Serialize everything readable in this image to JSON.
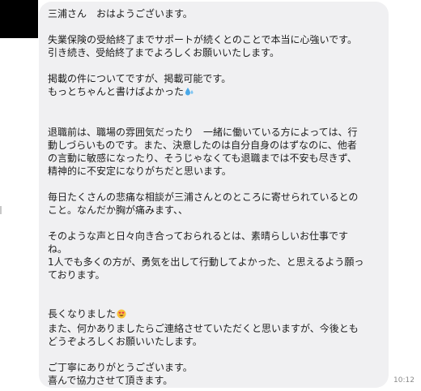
{
  "conversation": {
    "avatar_icon": "user-avatar-icon",
    "timestamp": "10:12",
    "message": {
      "greeting": "三浦さん　おはようございます。",
      "p1_l1": "失業保険の受給終了までサポートが続くとのことで本当に心強いです。",
      "p1_l2": "引き続き、受給終了までよろしくお願いいたします。",
      "p2_l1": "掲載の件についてですが、掲載可能です。",
      "p2_l2": "もっとちゃんと書けばよかった",
      "p2_emoji": "sweat-droplets-icon",
      "p3_l1": "退職前は、職場の雰囲気だったり　一緒に働いている方によっては、行",
      "p3_l2": "動しづらいものです。また、決意したのは自分自身のはずなのに、他者",
      "p3_l3": "の言動に敏感になったり、そうじゃなくても退職までは不安も尽きず、",
      "p3_l4": "精神的に不安定になりがちだと思います。",
      "p4_l1": "毎日たくさんの悲痛な相談が三浦さんとのところに寄せられているとの",
      "p4_l2": "こと。なんだか胸が痛みます、、",
      "p5_l1": "そのような声と日々向き合っておられるとは、素晴らしいお仕事です",
      "p5_l2": "ね。",
      "p5_l3": "1人でも多くの方が、勇気を出して行動してよかった、と思えるよう願っ",
      "p5_l4": "ております。",
      "p6_l1": "長くなりました",
      "p6_emoji": "smiling-face-with-heart-eyes-icon",
      "p6_l2": "また、何かありましたらご連絡させていただくと思いますが、今後とも",
      "p6_l3": "どうぞよろしくお願いいたします。",
      "p7_l1": "ご丁寧にありがとうございます。",
      "p7_l2": "喜んで協力させて頂きます。"
    }
  }
}
